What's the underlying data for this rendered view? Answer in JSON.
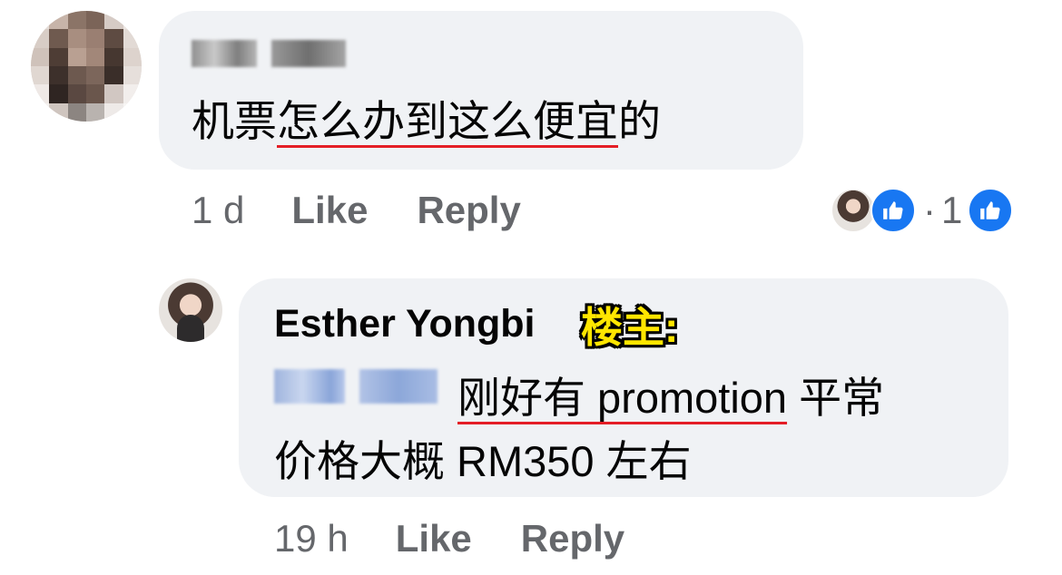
{
  "thread": {
    "comment": {
      "text_plain_1": "机票",
      "text_underlined": "怎么办到这么便宜",
      "text_plain_2": "的",
      "time": "1 d",
      "like_label": "Like",
      "reply_label": "Reply",
      "reaction_count": "1",
      "reaction_separator": "·"
    },
    "reply": {
      "author": "Esther Yongbi",
      "badge": "楼主:",
      "text_underlined": "刚好有 promotion",
      "text_after": " 平常",
      "text_line2": "价格大概 RM350 左右",
      "time": "19 h",
      "like_label": "Like",
      "reply_label": "Reply"
    }
  },
  "colors": {
    "bubble": "#f0f2f5",
    "meta_text": "#65676b",
    "underline": "#e41e26",
    "like_blue": "#1877f2",
    "badge_yellow": "#ffe600"
  },
  "icons": {
    "reaction": "like-thumb-icon"
  }
}
